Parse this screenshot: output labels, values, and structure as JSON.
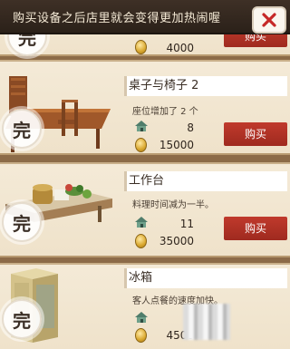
{
  "header": {
    "title": "购买设备之后店里就会变得更加热闹喔"
  },
  "close_icon": "close-x-icon",
  "badge_text": "完",
  "items": [
    {
      "name": "",
      "description": "",
      "stat": "",
      "price": "4000",
      "buy_label": "购买"
    },
    {
      "name": "桌子与椅子 2",
      "description": "座位增加了 2 个",
      "stat": "8",
      "price": "15000",
      "buy_label": "购买"
    },
    {
      "name": "工作台",
      "description": "料理时间减为一半。",
      "stat": "11",
      "price": "35000",
      "buy_label": "购买"
    },
    {
      "name": "冰箱",
      "description": "客人点餐的速度加快。",
      "stat": "",
      "price": "4500",
      "buy_label": ""
    }
  ],
  "colors": {
    "header_bg": "#2b2119",
    "buy_button": "#a52f22",
    "item_bg": "#f2e7d2",
    "close_x": "#c62828"
  }
}
